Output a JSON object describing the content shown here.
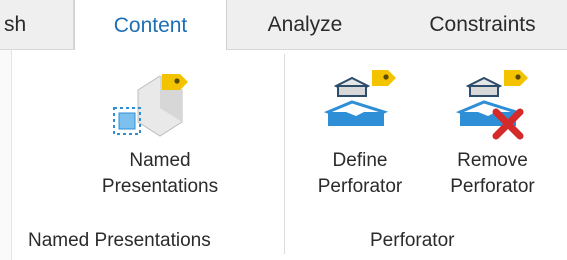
{
  "tabs": {
    "partial": "sh",
    "content": "Content",
    "analyze": "Analyze",
    "constraints": "Constraints"
  },
  "groups": {
    "named_presentations": {
      "label": "Named Presentations",
      "buttons": {
        "named_presentations": {
          "line1": "Named",
          "line2": "Presentations"
        }
      }
    },
    "perforator": {
      "label": "Perforator",
      "buttons": {
        "define": {
          "line1": "Define",
          "line2": "Perforator"
        },
        "remove": {
          "line1": "Remove",
          "line2": "Perforator"
        }
      }
    }
  },
  "colors": {
    "active_tab_text": "#1f6fb4",
    "icon_blue": "#2e8fd6",
    "icon_yellow": "#f3c300",
    "icon_red": "#d42a2a"
  }
}
